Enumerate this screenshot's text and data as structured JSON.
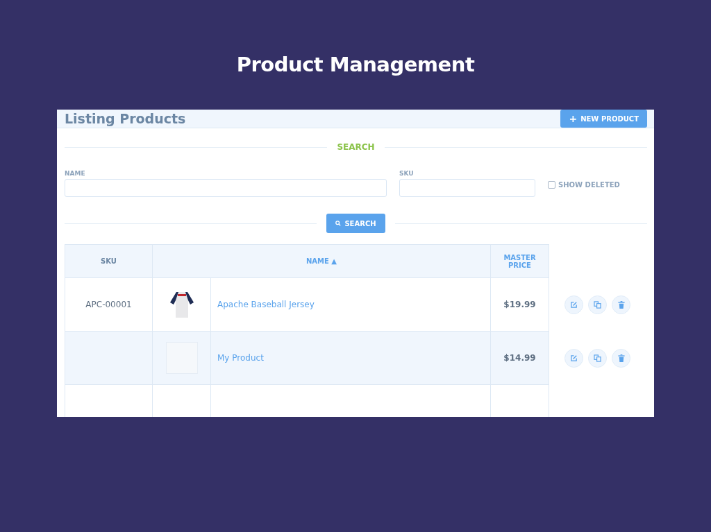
{
  "slide_title": "Product Management",
  "panel": {
    "title": "Listing Products",
    "new_button_icon": "+",
    "new_button": "NEW PRODUCT"
  },
  "search": {
    "heading": "SEARCH",
    "fields": [
      {
        "label": "NAME"
      },
      {
        "label": "SKU"
      }
    ],
    "show_deleted": {
      "label": "SHOW DELETED",
      "checked": false
    },
    "button": "SEARCH"
  },
  "table": {
    "columns": [
      "SKU",
      "NAME ▲",
      "MASTER PRICE"
    ],
    "rows": [
      {
        "sku": "APC-00001",
        "kind": "jersey",
        "name": "Apache Baseball Jersey",
        "price": "$19.99"
      },
      {
        "kind": "no-image",
        "name": "My Product",
        "price": "$14.99"
      }
    ]
  }
}
